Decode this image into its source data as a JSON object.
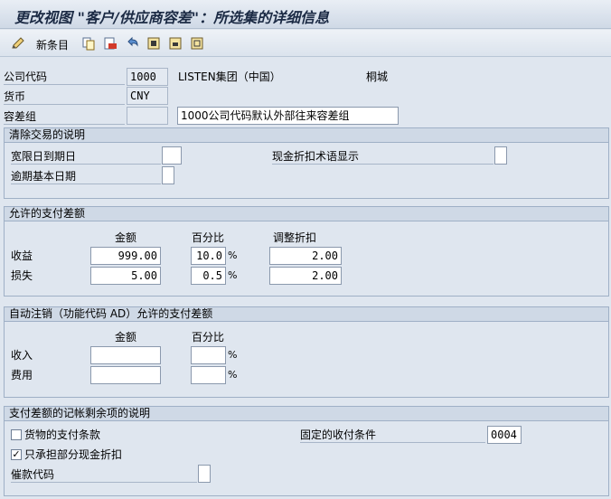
{
  "window": {
    "title": "更改视图 \"客户/供应商容差\"：所选集的详细信息"
  },
  "toolbar": {
    "new_entries_label": "新条目",
    "icons": [
      "edit-icon",
      "copy-icon",
      "delete-icon",
      "undo-icon",
      "select-all-icon",
      "select-block-icon",
      "deselect-all-icon"
    ]
  },
  "header": {
    "company_code_label": "公司代码",
    "company_code_value": "1000",
    "company_name": "LISTEN集团（中国）",
    "city": "桐城",
    "currency_label": "货币",
    "currency_value": "CNY",
    "tolerance_group_label": "容差组",
    "tolerance_group_value": "",
    "tolerance_group_desc": "1000公司代码默认外部往来容差组"
  },
  "clearing_section": {
    "title": "清除交易的说明",
    "grace_days_label": "宽限日到期日",
    "grace_days_value": "",
    "cash_discount_label": "现金折扣术语显示",
    "cash_discount_value": "",
    "arrears_base_label": "逾期基本日期",
    "arrears_base_value": ""
  },
  "payment_diff_section": {
    "title": "允许的支付差额",
    "col_amount": "金额",
    "col_percent": "百分比",
    "col_adjust": "调整折扣",
    "rows": [
      {
        "label": "收益",
        "amount": "999.00",
        "percent": "10.0",
        "adjust": "2.00"
      },
      {
        "label": "损失",
        "amount": "5.00",
        "percent": "0.5",
        "adjust": "2.00"
      }
    ],
    "percent_sign": "%"
  },
  "auto_writeoff_section": {
    "title": "自动注销（功能代码 AD）允许的支付差额",
    "col_amount": "金额",
    "col_percent": "百分比",
    "rows": [
      {
        "label": "收入",
        "amount": "",
        "percent": ""
      },
      {
        "label": "费用",
        "amount": "",
        "percent": ""
      }
    ],
    "percent_sign": "%"
  },
  "residual_section": {
    "title": "支付差额的记帐剩余项的说明",
    "terms_of_payment_label": "货物的支付条款",
    "terms_of_payment_checked": false,
    "partial_cash_discount_label": "只承担部分现金折扣",
    "partial_cash_discount_checked": true,
    "dunning_key_label": "催款代码",
    "dunning_key_value": "",
    "fixed_terms_label": "固定的收付条件",
    "fixed_terms_value": "0004"
  }
}
